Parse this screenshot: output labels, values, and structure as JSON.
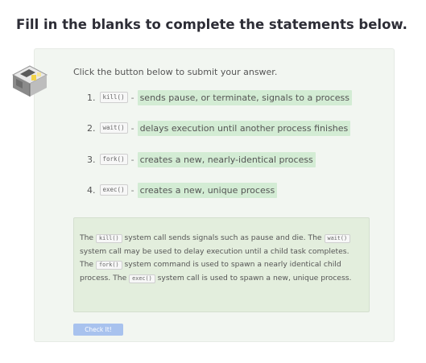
{
  "heading": "Fill in the blanks to complete the statements below.",
  "instruction": "Click the button below to submit your answer.",
  "items": [
    {
      "num": "1.",
      "code": "kill()",
      "dash": "-",
      "blank": "sends pause, or terminate, signals to a process"
    },
    {
      "num": "2.",
      "code": "wait()",
      "dash": "-",
      "blank": "delays execution until another process finishes"
    },
    {
      "num": "3.",
      "code": "fork()",
      "dash": "-",
      "blank": "creates a new, nearly-identical process"
    },
    {
      "num": "4.",
      "code": "exec()",
      "dash": "-",
      "blank": "creates a new, unique process"
    }
  ],
  "feedback": {
    "s1_pre": "The ",
    "s1_code": "kill()",
    "s1_post": " system call sends signals such as pause and die. The ",
    "s2_code": "wait()",
    "s2_post": " system call may be used to delay execution until a child task completes. The ",
    "s3_code": "fork()",
    "s3_post": " system command is used to spawn a nearly identical child process. The ",
    "s4_code": "exec()",
    "s4_post": " system call is used to spawn a new, unique process."
  },
  "check_button": "Check It!",
  "colors": {
    "card_bg": "#f2f6f1",
    "blank_bg": "#d3ecd4",
    "feedback_bg": "#e3eedd",
    "button_bg": "#a8c2ee"
  },
  "logo_icon": "isometric-room-icon"
}
